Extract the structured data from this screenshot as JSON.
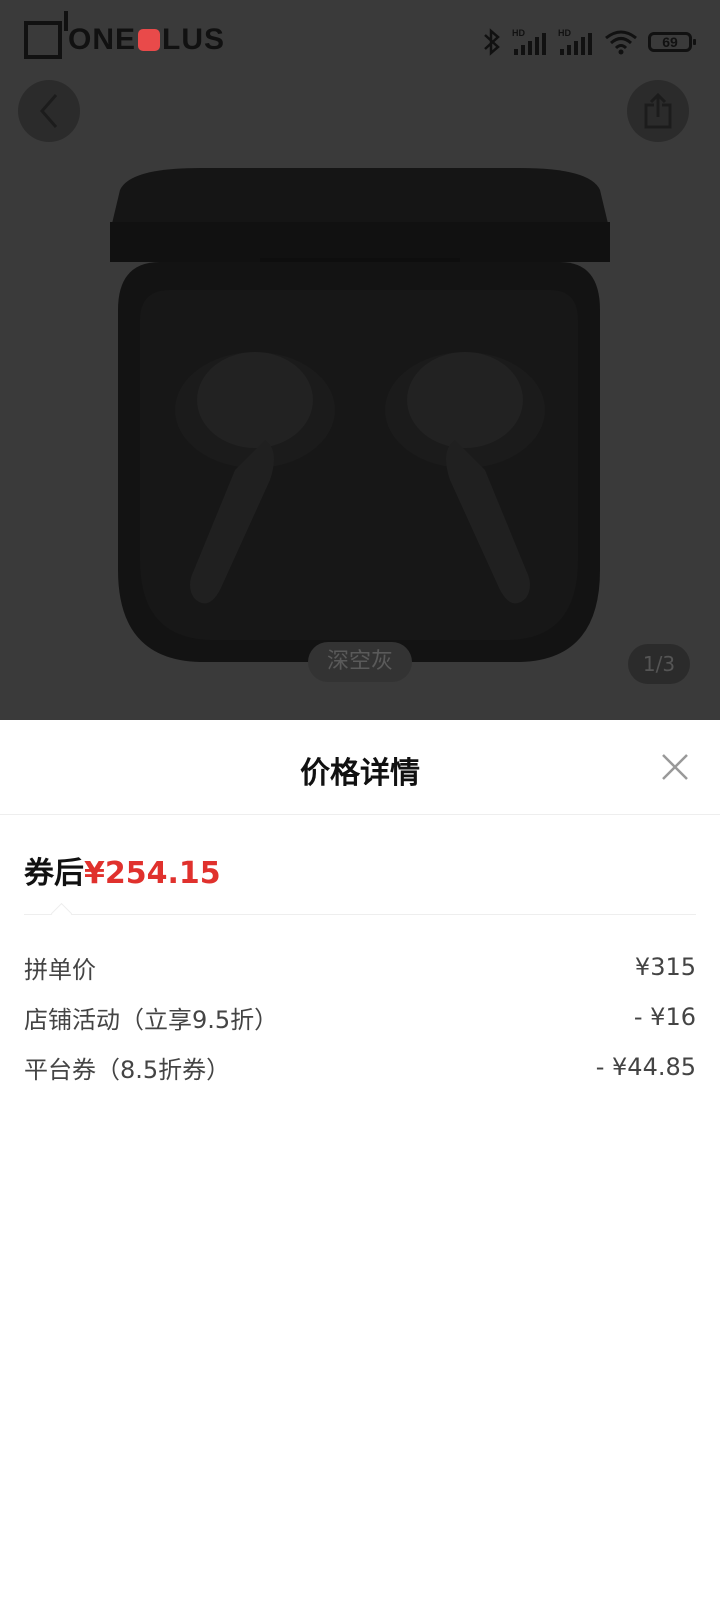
{
  "status_bar": {
    "brand": "ONE",
    "brand_suffix": "LUS",
    "battery": "69",
    "signal_label_1": "HD",
    "signal_label_2": "HD"
  },
  "gallery": {
    "color_label": "深空灰",
    "page_counter": "1/3"
  },
  "sheet": {
    "title": "价格详情",
    "final_price_label": "券后",
    "final_price_value": "¥254.15",
    "rows": [
      {
        "label": "拼单价",
        "amount": "¥315"
      },
      {
        "label": "店铺活动（立享9.5折）",
        "amount": "- ¥16"
      },
      {
        "label": "平台券（8.5折券）",
        "amount": "- ¥44.85"
      }
    ]
  },
  "colors": {
    "price_red": "#e0312d",
    "overlay": "#3a3a3a"
  }
}
